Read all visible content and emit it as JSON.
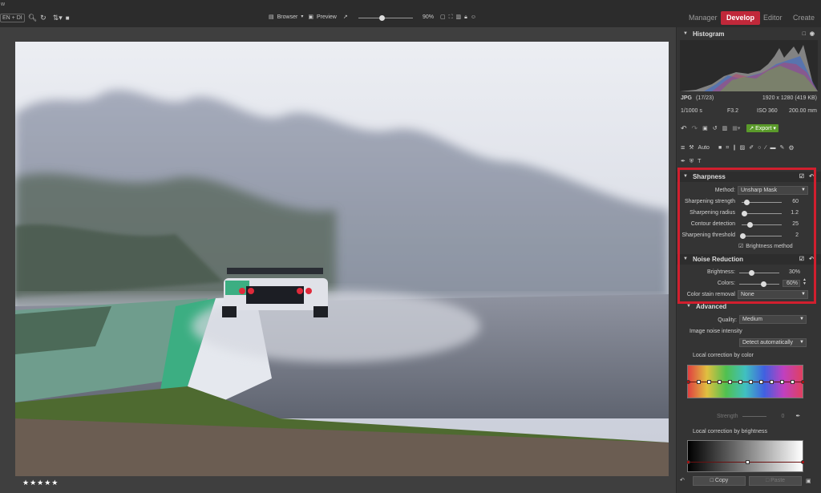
{
  "app": {
    "mark": "w"
  },
  "toolbar": {
    "lang_label": "EN + DI",
    "browser_label": "Browser",
    "preview_label": "Preview",
    "zoom_value": "90%",
    "zoom_level": 0.42
  },
  "modes": {
    "manager": "Manager",
    "develop": "Develop",
    "editor": "Editor",
    "create": "Create"
  },
  "histogram": {
    "title": "Histogram",
    "format": "JPG",
    "index": "(17/23)",
    "dimensions": "1920 x 1280 (419 KB)",
    "shutter": "1/1000 s",
    "aperture": "F3.2",
    "iso": "ISO 360",
    "focal": "200.00 mm"
  },
  "tools": {
    "auto_label": "Auto",
    "export_label": "Export"
  },
  "sharpness": {
    "title": "Sharpness",
    "method_label": "Method:",
    "method_value": "Unsharp Mask",
    "strength_label": "Sharpening strength",
    "strength_value": "60",
    "strength_level": 0.12,
    "radius_label": "Sharpening radius",
    "radius_value": "1.2",
    "radius_level": 0.05,
    "contour_label": "Contour detection",
    "contour_value": "25",
    "contour_level": 0.2,
    "threshold_label": "Sharpening threshold",
    "threshold_value": "2",
    "threshold_level": 0.02,
    "brightness_method_label": "Brightness method"
  },
  "noise": {
    "title": "Noise Reduction",
    "brightness_label": "Brightness:",
    "brightness_value": "30%",
    "brightness_level": 0.3,
    "colors_label": "Colors:",
    "colors_value": "60%",
    "colors_level": 0.6,
    "stain_label": "Color stain removal",
    "stain_value": "None"
  },
  "advanced": {
    "title": "Advanced",
    "quality_label": "Quality:",
    "quality_value": "Medium",
    "intensity_label": "Image noise intensity",
    "intensity_value": "Detect automatically",
    "local_color_label": "Local correction by color",
    "strength_label": "Strength",
    "strength_value": "0",
    "local_brightness_label": "Local correction by brightness"
  },
  "bottom": {
    "copy_label": "Copy",
    "paste_label": "Paste"
  },
  "photo": {
    "rating": "★★★★★"
  },
  "colors": {
    "accent": "#c0283a",
    "export": "#5a9a2a",
    "highlight": "#d11f2e"
  }
}
